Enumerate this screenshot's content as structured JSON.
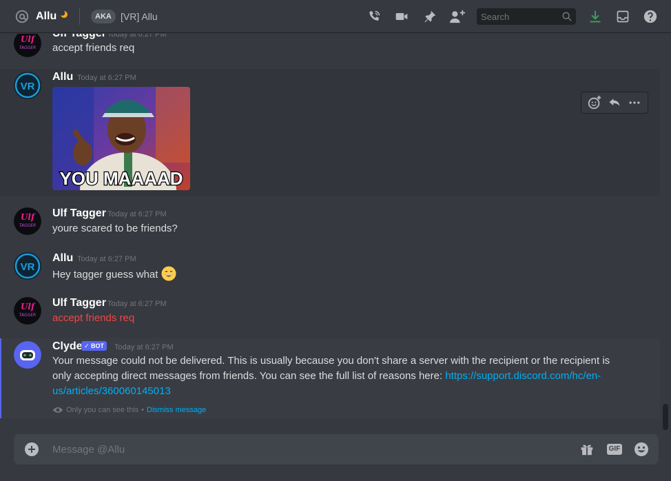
{
  "header": {
    "title": "Allu",
    "aka_label": "AKA",
    "aka_name": "[VR] Allu",
    "search_placeholder": "Search",
    "colors": {
      "download": "#3ba55d",
      "background": "#36393f"
    }
  },
  "messages": [
    {
      "author": "Ulf Tagger",
      "timestamp": "Today at 6:27 PM",
      "text": "accept friends req",
      "avatar": "ulf-tagger-logo"
    },
    {
      "author": "Allu",
      "timestamp": "Today at 6:27 PM",
      "avatar": "vr-logo",
      "image_caption": "YOU MAAAAD"
    },
    {
      "author": "Ulf Tagger",
      "timestamp": "Today at 6:27 PM",
      "text": "youre scared to be friends?",
      "avatar": "ulf-tagger-logo"
    },
    {
      "author": "Allu",
      "timestamp": "Today at 6:27 PM",
      "text": "Hey tagger guess what",
      "emoji": "😄",
      "avatar": "vr-logo"
    },
    {
      "author": "Ulf Tagger",
      "timestamp": "Today at 6:27 PM",
      "text": "accept friends req",
      "avatar": "ulf-tagger-logo",
      "failed": true
    }
  ],
  "clyde": {
    "author": "Clyde",
    "bot_tag": "✓ BOT",
    "timestamp": "Today at 6:27 PM",
    "text": "Your message could not be delivered. This is usually because you don't share a server with the recipient or the recipient is only accepting direct messages from friends. You can see the full list of reasons here: ",
    "link": "https://support.discord.com/hc/en-us/articles/360060145013",
    "only_you": "Only you can see this",
    "separator": "•",
    "dismiss": "Dismiss message"
  },
  "composer": {
    "placeholder": "Message @Allu"
  }
}
